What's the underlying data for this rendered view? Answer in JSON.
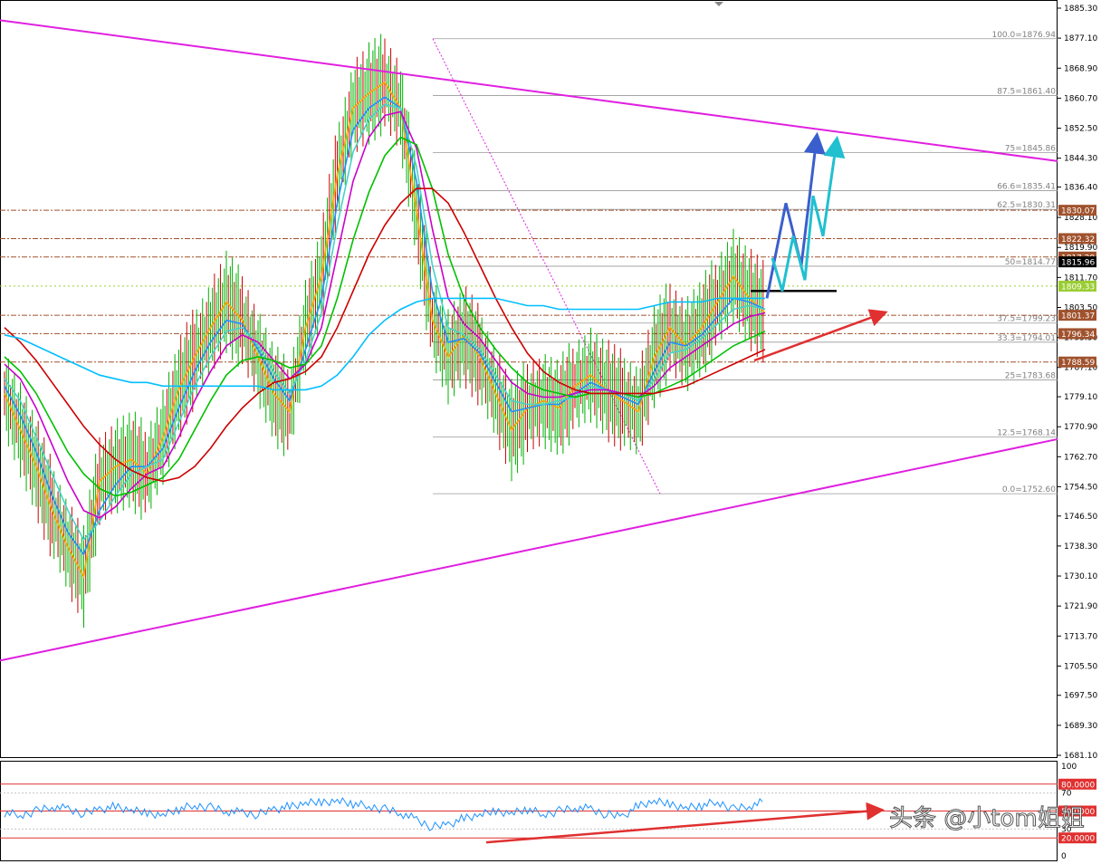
{
  "chart_data": {
    "type": "line",
    "main_panel": {
      "y_axis_ticks": [
        "1885.30",
        "1877.10",
        "1868.90",
        "1860.70",
        "1852.50",
        "1844.30",
        "1836.40",
        "1828.10",
        "1819.90",
        "1811.70",
        "1803.50",
        "1795.30",
        "1787.10",
        "1779.10",
        "1770.90",
        "1762.70",
        "1754.50",
        "1746.50",
        "1738.30",
        "1730.10",
        "1721.90",
        "1713.70",
        "1705.50",
        "1697.50",
        "1689.30",
        "1681.10"
      ],
      "y_range": [
        1681.1,
        1885.3
      ],
      "fibonacci": {
        "high": 1876.94,
        "low": 1752.6,
        "levels": [
          {
            "label": "100.0=1876.94",
            "price": 1876.94
          },
          {
            "label": "87.5=1861.40",
            "price": 1861.4
          },
          {
            "label": "75=1845.86",
            "price": 1845.86
          },
          {
            "label": "66.6=1835.41",
            "price": 1835.41
          },
          {
            "label": "62.5=1830.31",
            "price": 1830.31
          },
          {
            "label": "50=1814.77",
            "price": 1814.77
          },
          {
            "label": "37.5=1799.23",
            "price": 1799.23
          },
          {
            "label": "33.3=1794.01",
            "price": 1794.01
          },
          {
            "label": "25=1783.68",
            "price": 1783.68
          },
          {
            "label": "12.5=1768.14",
            "price": 1768.14
          },
          {
            "label": "0.0=1752.60",
            "price": 1752.6
          }
        ]
      },
      "price_tags": [
        {
          "label": "1830.07",
          "price": 1830.07,
          "color": "#a0522d"
        },
        {
          "label": "1822.32",
          "price": 1822.32,
          "color": "#a0522d"
        },
        {
          "label": "1817.29",
          "price": 1817.29,
          "color": "#a0522d"
        },
        {
          "label": "1815.96",
          "price": 1815.96,
          "color": "#000000"
        },
        {
          "label": "1809.33",
          "price": 1809.33,
          "color": "#9acd32"
        },
        {
          "label": "1801.37",
          "price": 1801.37,
          "color": "#a0522d"
        },
        {
          "label": "1796.34",
          "price": 1796.34,
          "color": "#a0522d"
        },
        {
          "label": "1788.59",
          "price": 1788.59,
          "color": "#a0522d"
        }
      ],
      "trend_lines": [
        {
          "name": "upper",
          "from_price": 1882.0,
          "to_price": 1843.5,
          "color": "#e020e0"
        },
        {
          "name": "lower",
          "from_price": 1707.0,
          "to_price": 1767.5,
          "color": "#e020e0"
        }
      ],
      "moving_averages": [
        {
          "color": "#ffa500",
          "values": [
            1780,
            1770,
            1760,
            1748,
            1738,
            1730,
            1756,
            1760,
            1762,
            1758,
            1768,
            1781,
            1790,
            1798,
            1805,
            1800,
            1790,
            1780,
            1775,
            1798,
            1812,
            1840,
            1858,
            1862,
            1865,
            1858,
            1830,
            1800,
            1790,
            1796,
            1790,
            1780,
            1770,
            1776,
            1778,
            1776,
            1782,
            1785,
            1781,
            1778,
            1775,
            1790,
            1798,
            1793,
            1798,
            1805,
            1812,
            1806,
            1802
          ]
        },
        {
          "color": "#1e90ff",
          "values": [
            1782,
            1774,
            1764,
            1752,
            1742,
            1736,
            1748,
            1755,
            1760,
            1760,
            1765,
            1776,
            1786,
            1794,
            1800,
            1799,
            1792,
            1784,
            1778,
            1792,
            1806,
            1832,
            1852,
            1858,
            1861,
            1858,
            1838,
            1808,
            1794,
            1795,
            1791,
            1783,
            1775,
            1776,
            1777,
            1777,
            1780,
            1783,
            1781,
            1779,
            1777,
            1786,
            1794,
            1793,
            1796,
            1801,
            1806,
            1805,
            1803
          ]
        },
        {
          "color": "#48d1cc",
          "values": [
            1784,
            1778,
            1768,
            1758,
            1748,
            1740,
            1745,
            1752,
            1758,
            1760,
            1762,
            1772,
            1782,
            1790,
            1797,
            1798,
            1793,
            1786,
            1780,
            1789,
            1802,
            1826,
            1846,
            1855,
            1859,
            1858,
            1842,
            1815,
            1798,
            1796,
            1792,
            1785,
            1778,
            1777,
            1777,
            1778,
            1779,
            1782,
            1781,
            1780,
            1778,
            1784,
            1791,
            1792,
            1795,
            1799,
            1803,
            1804,
            1803
          ]
        },
        {
          "color": "#cc00cc",
          "values": [
            1788,
            1784,
            1776,
            1766,
            1756,
            1748,
            1746,
            1749,
            1754,
            1758,
            1760,
            1768,
            1778,
            1786,
            1793,
            1796,
            1794,
            1789,
            1784,
            1788,
            1798,
            1818,
            1838,
            1850,
            1856,
            1857,
            1847,
            1825,
            1806,
            1799,
            1795,
            1789,
            1783,
            1780,
            1779,
            1779,
            1780,
            1781,
            1781,
            1780,
            1779,
            1782,
            1787,
            1790,
            1793,
            1796,
            1799,
            1801,
            1802
          ]
        },
        {
          "color": "#00c000",
          "values": [
            1790,
            1786,
            1780,
            1772,
            1764,
            1758,
            1754,
            1752,
            1753,
            1755,
            1757,
            1762,
            1770,
            1778,
            1785,
            1789,
            1790,
            1789,
            1787,
            1788,
            1793,
            1806,
            1822,
            1835,
            1845,
            1850,
            1848,
            1836,
            1818,
            1806,
            1798,
            1792,
            1787,
            1783,
            1781,
            1780,
            1779,
            1780,
            1780,
            1780,
            1779,
            1780,
            1782,
            1784,
            1787,
            1790,
            1793,
            1795,
            1797
          ]
        },
        {
          "color": "#cc0000",
          "values": [
            1798,
            1794,
            1789,
            1783,
            1777,
            1771,
            1766,
            1762,
            1759,
            1757,
            1756,
            1757,
            1760,
            1765,
            1771,
            1776,
            1780,
            1783,
            1784,
            1786,
            1790,
            1798,
            1808,
            1818,
            1826,
            1832,
            1836,
            1836,
            1832,
            1824,
            1815,
            1806,
            1798,
            1791,
            1786,
            1783,
            1781,
            1780,
            1780,
            1780,
            1780,
            1780,
            1781,
            1782,
            1784,
            1786,
            1788,
            1790,
            1792
          ]
        },
        {
          "color": "#00bfff",
          "values": [
            1796,
            1795,
            1793,
            1791,
            1789,
            1787,
            1785,
            1784,
            1783,
            1783,
            1782,
            1782,
            1782,
            1782,
            1782,
            1782,
            1782,
            1781,
            1781,
            1781,
            1782,
            1785,
            1790,
            1796,
            1800,
            1803,
            1805,
            1806,
            1806,
            1806,
            1806,
            1806,
            1805,
            1804,
            1804,
            1803,
            1803,
            1803,
            1803,
            1803,
            1803,
            1804,
            1805,
            1805,
            1805,
            1806,
            1806,
            1806,
            1806
          ]
        }
      ],
      "candles": [
        1780,
        1770,
        1760,
        1748,
        1738,
        1730,
        1756,
        1760,
        1762,
        1758,
        1768,
        1781,
        1790,
        1798,
        1805,
        1800,
        1790,
        1780,
        1775,
        1798,
        1812,
        1840,
        1858,
        1862,
        1865,
        1858,
        1830,
        1800,
        1790,
        1796,
        1790,
        1780,
        1770,
        1776,
        1778,
        1776,
        1782,
        1785,
        1781,
        1778,
        1775,
        1790,
        1798,
        1793,
        1798,
        1805,
        1812,
        1806,
        1802
      ]
    },
    "rsi_panel": {
      "y_axis_ticks": [
        "100",
        "80.0000",
        "70",
        "50.0000",
        "30",
        "20.0000",
        "0"
      ],
      "y_range": [
        0,
        100
      ],
      "levels": [
        80,
        50,
        20
      ],
      "values": [
        48,
        45,
        50,
        55,
        52,
        47,
        52,
        55,
        50,
        48,
        46,
        52,
        56,
        54,
        50,
        48,
        46,
        52,
        55,
        58,
        60,
        62,
        58,
        55,
        52,
        48,
        40,
        32,
        35,
        42,
        45,
        50,
        48,
        52,
        46,
        50,
        54,
        52,
        46,
        44,
        56,
        60,
        58,
        54,
        56,
        60,
        52,
        56,
        60
      ]
    }
  },
  "watermark": "头条 @小tom姐姐"
}
